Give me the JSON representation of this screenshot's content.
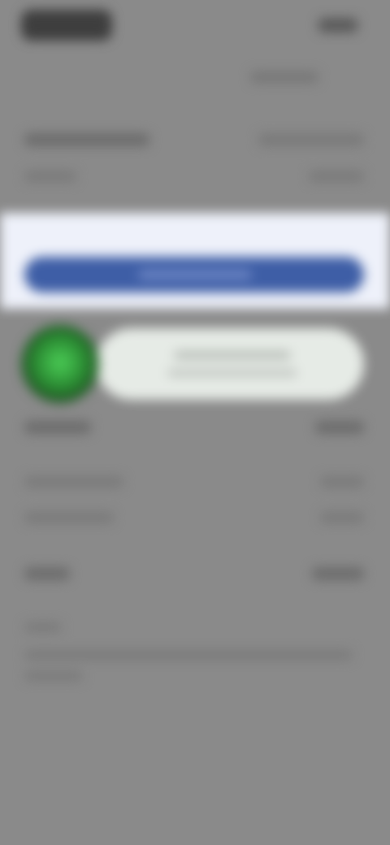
{
  "screen": {
    "state": "blurred-loading",
    "colors": {
      "background": "#8a8a8a",
      "band": "#eef1fa",
      "primary_button": "#3e5ea6",
      "avatar_green": "#2a8a32",
      "pill": "#e6ebe6"
    }
  },
  "status_bar": {
    "time": "",
    "icons": ""
  },
  "header": {
    "link": ""
  },
  "summary": {
    "title": "",
    "right_value": "",
    "subtitle": ""
  },
  "cta": {
    "label": ""
  },
  "toast": {
    "line1": "",
    "line2": ""
  },
  "details": {
    "rows": [
      {
        "label": "",
        "value": ""
      },
      {
        "label": "",
        "value": ""
      },
      {
        "label": "",
        "value": ""
      },
      {
        "label": "",
        "value": ""
      }
    ],
    "note_title": "",
    "note_text": ""
  },
  "icons": {
    "avatar": "user-avatar-icon"
  }
}
